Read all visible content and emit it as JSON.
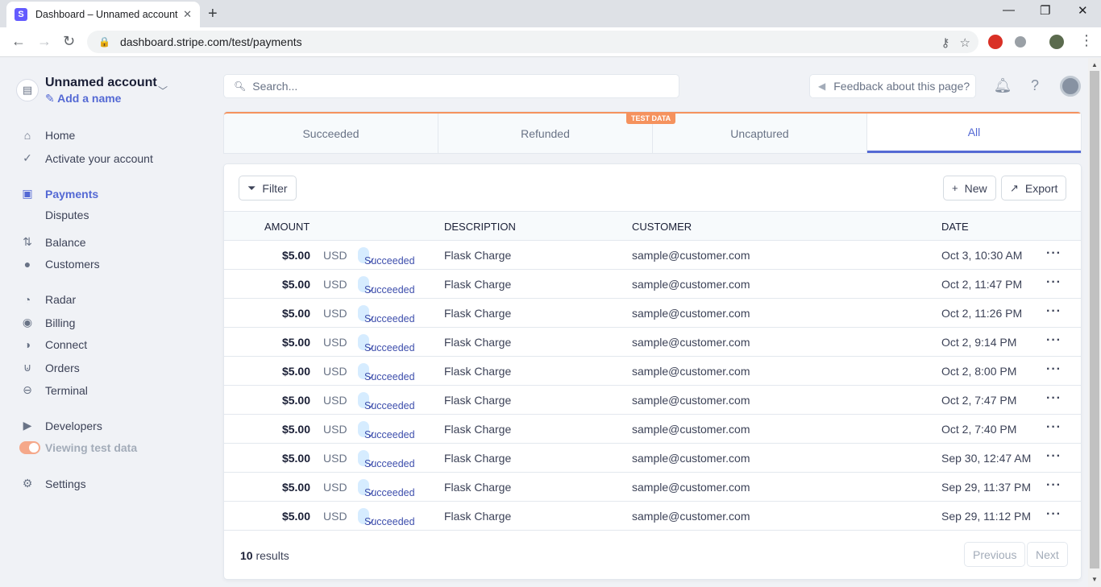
{
  "browser": {
    "tab_title": "Dashboard – Unnamed account –",
    "favicon_letter": "S",
    "url": "dashboard.stripe.com/test/payments"
  },
  "sidebar": {
    "account_name": "Unnamed account",
    "add_name": "Add a name",
    "items": {
      "home": "Home",
      "activate": "Activate your account",
      "payments": "Payments",
      "disputes": "Disputes",
      "balance": "Balance",
      "customers": "Customers",
      "radar": "Radar",
      "billing": "Billing",
      "connect": "Connect",
      "orders": "Orders",
      "terminal": "Terminal",
      "developers": "Developers",
      "viewing_test": "Viewing test data",
      "settings": "Settings"
    }
  },
  "topbar": {
    "search_placeholder": "Search...",
    "feedback": "Feedback about this page?"
  },
  "status_tabs": [
    "Succeeded",
    "Refunded",
    "Uncaptured",
    "All"
  ],
  "active_tab": "All",
  "test_badge": "TEST DATA",
  "toolbar": {
    "filter": "Filter",
    "new": "New",
    "export": "Export"
  },
  "table": {
    "headers": {
      "amount": "AMOUNT",
      "description": "DESCRIPTION",
      "customer": "CUSTOMER",
      "date": "DATE"
    },
    "rows": [
      {
        "amount": "$5.00",
        "currency": "USD",
        "status": "Succeeded",
        "description": "Flask Charge",
        "customer": "sample@customer.com",
        "date": "Oct 3, 10:30 AM"
      },
      {
        "amount": "$5.00",
        "currency": "USD",
        "status": "Succeeded",
        "description": "Flask Charge",
        "customer": "sample@customer.com",
        "date": "Oct 2, 11:47 PM"
      },
      {
        "amount": "$5.00",
        "currency": "USD",
        "status": "Succeeded",
        "description": "Flask Charge",
        "customer": "sample@customer.com",
        "date": "Oct 2, 11:26 PM"
      },
      {
        "amount": "$5.00",
        "currency": "USD",
        "status": "Succeeded",
        "description": "Flask Charge",
        "customer": "sample@customer.com",
        "date": "Oct 2, 9:14 PM"
      },
      {
        "amount": "$5.00",
        "currency": "USD",
        "status": "Succeeded",
        "description": "Flask Charge",
        "customer": "sample@customer.com",
        "date": "Oct 2, 8:00 PM"
      },
      {
        "amount": "$5.00",
        "currency": "USD",
        "status": "Succeeded",
        "description": "Flask Charge",
        "customer": "sample@customer.com",
        "date": "Oct 2, 7:47 PM"
      },
      {
        "amount": "$5.00",
        "currency": "USD",
        "status": "Succeeded",
        "description": "Flask Charge",
        "customer": "sample@customer.com",
        "date": "Oct 2, 7:40 PM"
      },
      {
        "amount": "$5.00",
        "currency": "USD",
        "status": "Succeeded",
        "description": "Flask Charge",
        "customer": "sample@customer.com",
        "date": "Sep 30, 12:47 AM"
      },
      {
        "amount": "$5.00",
        "currency": "USD",
        "status": "Succeeded",
        "description": "Flask Charge",
        "customer": "sample@customer.com",
        "date": "Sep 29, 11:37 PM"
      },
      {
        "amount": "$5.00",
        "currency": "USD",
        "status": "Succeeded",
        "description": "Flask Charge",
        "customer": "sample@customer.com",
        "date": "Sep 29, 11:12 PM"
      }
    ]
  },
  "footer": {
    "count": "10",
    "count_suffix": " results",
    "previous": "Previous",
    "next": "Next"
  },
  "colors": {
    "accent": "#5469d4",
    "test_orange": "#f5925e",
    "badge_bg": "#d6ecff"
  }
}
